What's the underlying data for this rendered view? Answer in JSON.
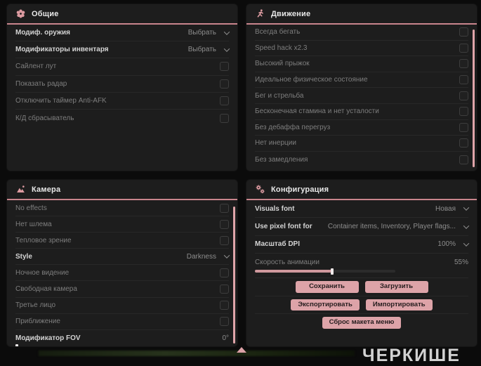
{
  "colors": {
    "accent_pink": "#dda3a8",
    "header_underline": "#c9858d",
    "panel_bg": "#1d1d1d",
    "page_bg": "#0b0b0b"
  },
  "watermark": "ЧЕРКИШЕ",
  "panels": {
    "general": {
      "title": "Общие",
      "rows": [
        {
          "label": "Модиф. оружия",
          "type": "dropdown",
          "value": "Выбрать",
          "bright": true
        },
        {
          "label": "Модификаторы инвентаря",
          "type": "dropdown",
          "value": "Выбрать",
          "bright": true
        },
        {
          "label": "Сайлент лут",
          "type": "checkbox",
          "checked": false
        },
        {
          "label": "Показать радар",
          "type": "checkbox",
          "checked": false
        },
        {
          "label": "Отключить таймер Anti-AFK",
          "type": "checkbox",
          "checked": false
        },
        {
          "label": "К/Д сбрасыватель",
          "type": "checkbox",
          "checked": false
        }
      ]
    },
    "movement": {
      "title": "Движение",
      "scrollbar": true,
      "rows": [
        {
          "label": "Всегда бегать",
          "type": "checkbox",
          "checked": false
        },
        {
          "label": "Speed hack x2.3",
          "type": "checkbox",
          "checked": false
        },
        {
          "label": "Высокий прыжок",
          "type": "checkbox",
          "checked": false
        },
        {
          "label": "Идеальное физическое состояние",
          "type": "checkbox",
          "checked": false
        },
        {
          "label": "Бег и стрельба",
          "type": "checkbox",
          "checked": false
        },
        {
          "label": "Бесконечная стамина и нет усталости",
          "type": "checkbox",
          "checked": false
        },
        {
          "label": "Без дебаффа перегруз",
          "type": "checkbox",
          "checked": false
        },
        {
          "label": "Нет инерции",
          "type": "checkbox",
          "checked": false
        },
        {
          "label": "Без замедления",
          "type": "checkbox",
          "checked": false
        }
      ]
    },
    "camera": {
      "title": "Камера",
      "scrollbar": true,
      "rows": [
        {
          "label": "No effects",
          "type": "checkbox",
          "checked": false
        },
        {
          "label": "Нет шлема",
          "type": "checkbox",
          "checked": false
        },
        {
          "label": "Тепловое зрение",
          "type": "checkbox",
          "checked": false
        },
        {
          "label": "Style",
          "type": "dropdown",
          "value": "Darkness",
          "bright": true
        },
        {
          "label": "Ночное видение",
          "type": "checkbox",
          "checked": false
        },
        {
          "label": "Свободная камера",
          "type": "checkbox",
          "checked": false
        },
        {
          "label": "Третье лицо",
          "type": "checkbox",
          "checked": false
        },
        {
          "label": "Приближение",
          "type": "checkbox",
          "checked": false
        },
        {
          "label": "Модификатор FOV",
          "type": "slider",
          "value": "0°",
          "percent": 0,
          "track_width": 280,
          "bright": true
        }
      ]
    },
    "config": {
      "title": "Конфигурация",
      "rows": [
        {
          "label": "Visuals font",
          "type": "dropdown",
          "value": "Новая",
          "bright": true
        },
        {
          "label": "Use pixel font for",
          "type": "dropdown",
          "value": "Container items, Inventory, Player flags...",
          "bright": true
        },
        {
          "label": "Масштаб DPI",
          "type": "dropdown",
          "value": "100%",
          "bright": true
        },
        {
          "label": "Скорость анимации",
          "type": "slider",
          "value": "55%",
          "percent": 55,
          "track_width": 200,
          "bright": false
        },
        {
          "type": "buttons",
          "buttons": [
            "Сохранить",
            "Загрузить"
          ]
        },
        {
          "type": "buttons",
          "buttons": [
            "Экспортировать",
            "Импортировать"
          ]
        },
        {
          "type": "buttons",
          "buttons": [
            "Сброс макета меню"
          ]
        }
      ]
    }
  }
}
